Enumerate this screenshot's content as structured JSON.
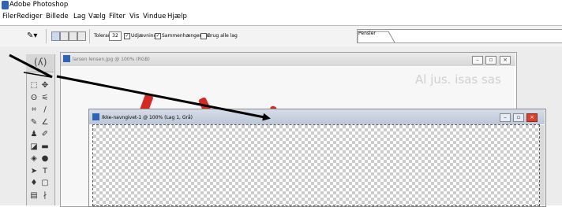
{
  "window_title": "Adobe Photoshop",
  "menu": [
    "Filer",
    "Rediger",
    "Billede",
    "Lag",
    "Vælg",
    "Filter",
    "Vis",
    "Vindue",
    "Hjælp"
  ],
  "options_bar": {
    "tolerance_label": "Tolerance:",
    "tolerance_value": "32",
    "antialias_label": "Udjævning",
    "contiguous_label": "Sammenhængende",
    "sample_all_label": "Brug alle lag",
    "antialias_checked": true,
    "contiguous_checked": true,
    "sample_all_checked": false,
    "palette_tab": "Pensler"
  },
  "toolbox": {
    "header_glyph": "(ʎ)",
    "tools": [
      {
        "name": "marquee-tool",
        "glyph": "⬚"
      },
      {
        "name": "move-tool",
        "glyph": "✥"
      },
      {
        "name": "lasso-tool",
        "glyph": "ʘ"
      },
      {
        "name": "magic-wand-tool",
        "glyph": "⚟"
      },
      {
        "name": "crop-tool",
        "glyph": "⌗"
      },
      {
        "name": "slice-tool",
        "glyph": "∕"
      },
      {
        "name": "healing-brush-tool",
        "glyph": "✎"
      },
      {
        "name": "brush-tool",
        "glyph": "∠"
      },
      {
        "name": "clone-stamp-tool",
        "glyph": "♟"
      },
      {
        "name": "history-brush-tool",
        "glyph": "✐"
      },
      {
        "name": "eraser-tool",
        "glyph": "◪"
      },
      {
        "name": "gradient-tool",
        "glyph": "▬"
      },
      {
        "name": "blur-tool",
        "glyph": "◈"
      },
      {
        "name": "dodge-tool",
        "glyph": "●"
      },
      {
        "name": "path-selection-tool",
        "glyph": "➤"
      },
      {
        "name": "type-tool",
        "glyph": "T"
      },
      {
        "name": "pen-tool",
        "glyph": "♦"
      },
      {
        "name": "shape-tool",
        "glyph": "▢"
      },
      {
        "name": "notes-tool",
        "glyph": "▤"
      },
      {
        "name": "eyedropper-tool",
        "glyph": "∤"
      }
    ]
  },
  "window1": {
    "title": "larsen lensen.jpg @ 100% (RGB)",
    "background_text": "Al jus. isas sas"
  },
  "window2": {
    "title": "Ikke-navngivet-1 @ 100% (Lag 1, Grå)"
  },
  "colors": {
    "accent_red": "#d42a23",
    "close_button": "#d9402b",
    "titlebar_active": "#bcc6d8"
  }
}
